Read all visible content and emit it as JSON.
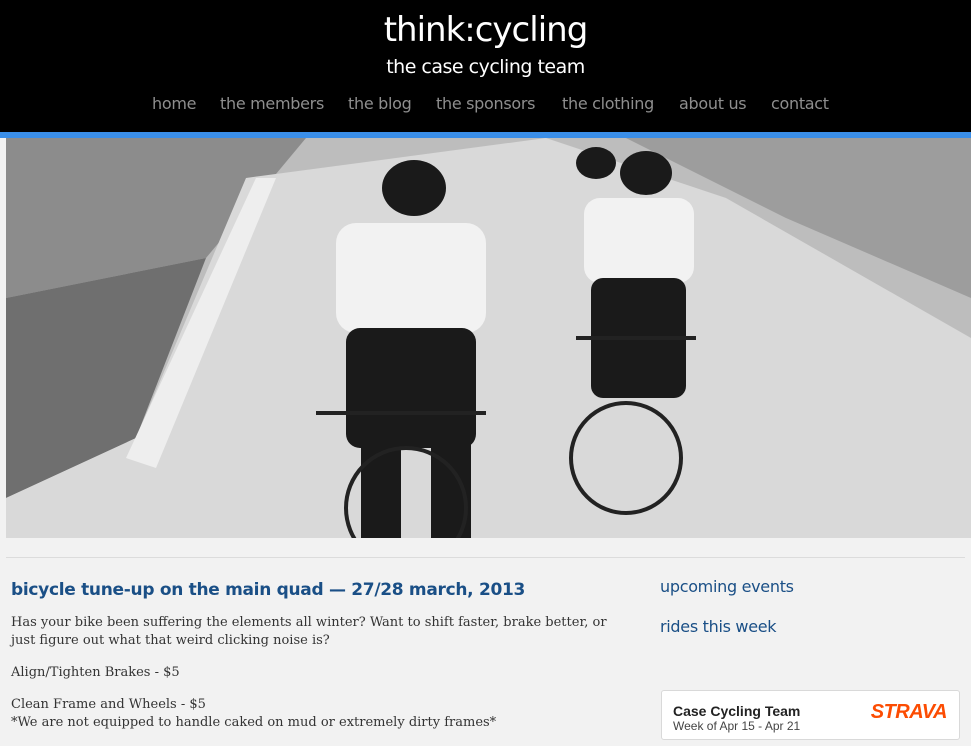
{
  "header": {
    "site_title": "think:cycling",
    "tagline": "the case cycling team"
  },
  "nav": {
    "items": [
      {
        "label": "home"
      },
      {
        "label": "the members"
      },
      {
        "label": "the blog"
      },
      {
        "label": "the sponsors"
      },
      {
        "label": "the clothing"
      },
      {
        "label": "about us"
      },
      {
        "label": "contact"
      }
    ]
  },
  "colors": {
    "nav_text": "#8e8e8e",
    "accent_bar": "#3a8ee8",
    "link_heading": "#1a4f86",
    "strava_orange": "#fc4c02"
  },
  "hero": {
    "image_alt": "cyclists in team kit riding on a wet road"
  },
  "post": {
    "title": "bicycle tune-up on the main quad — 27/28 march, 2013",
    "intro": "Has your bike been suffering the elements all winter? Want to shift faster, brake better, or just figure out what that weird clicking noise is?",
    "item_brakes": "Align/Tighten Brakes - $5",
    "item_clean": "Clean Frame and Wheels - $5",
    "item_clean_note": "*We are not equipped to handle caked on mud or extremely dirty frames*"
  },
  "sidebar": {
    "upcoming_events": "upcoming events",
    "rides_this_week": "rides this week"
  },
  "strava_widget": {
    "team_name": "Case Cycling Team",
    "week": "Week of Apr 15 - Apr 21",
    "logo_text": "STRAVA"
  }
}
